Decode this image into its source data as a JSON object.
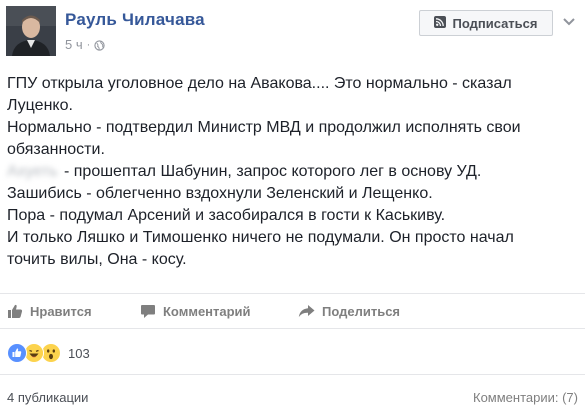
{
  "header": {
    "author_name": "Рауль Чилачава",
    "timestamp": "5 ч",
    "separator": "·",
    "subscribe_label": "Подписаться",
    "icons": {
      "avatar": "profile-photo",
      "globe": "globe-icon",
      "subscribe": "rss-icon",
      "menu": "chevron-down-icon"
    }
  },
  "post": {
    "lines": [
      "ГПУ открыла уголовное дело на Авакова.... Это нормально - сказал",
      "Луценко.",
      "Нормально - подтвердил Министр МВД и продолжил исполнять свои",
      "обязанности.",
      "- прошептал Шабунин, запрос которого лег в основу УД.",
      "Зашибись - облегченно вздохнули Зеленский и Лещенко.",
      "Пора - подумал Арсений и засобирался в гости к Каськиву.",
      "И только Ляшко и Тимошенко ничего не подумали. Он просто начал",
      "точить вилы, Она - косу."
    ],
    "redacted_word": "Ахуеть"
  },
  "actions": {
    "like_label": "Нравится",
    "comment_label": "Комментарий",
    "share_label": "Поделиться"
  },
  "reactions": {
    "types": [
      "like",
      "haha",
      "wow"
    ],
    "count": "103"
  },
  "footer": {
    "shares": "4 публикации",
    "comments": "Комментарии: (7)"
  },
  "colors": {
    "link_blue": "#365899",
    "text": "#1d2129",
    "muted": "#90949c",
    "like_blue": "#5890ff",
    "emoji_yellow": "#fcd34d"
  }
}
